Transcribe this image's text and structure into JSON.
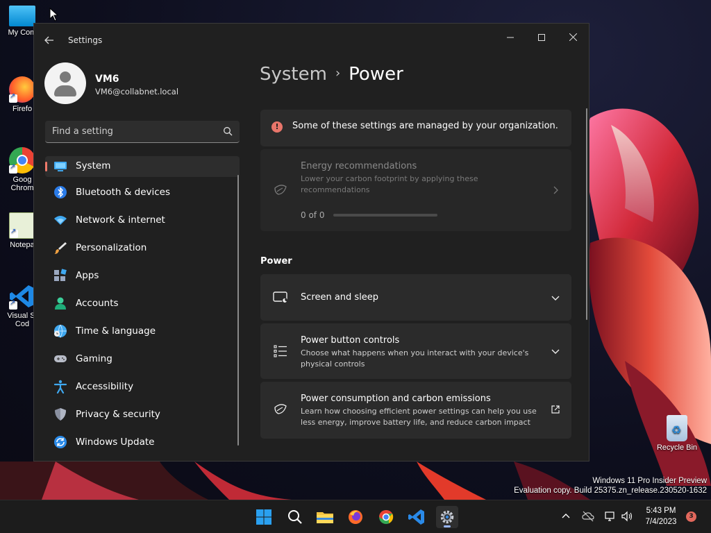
{
  "desktop": {
    "icons": [
      {
        "label": "My Com"
      },
      {
        "label": "Firefo"
      },
      {
        "label": "Goog Chrom"
      },
      {
        "label": "Notepa"
      },
      {
        "label": "Visual St Cod"
      },
      {
        "label": "Recycle Bin"
      }
    ],
    "watermark": {
      "line1": "Windows 11 Pro Insider Preview",
      "line2": "Evaluation copy. Build 25375.zn_release.230520-1632"
    }
  },
  "window": {
    "title": "Settings",
    "controls": {
      "minimize": "—",
      "maximize": "☐",
      "close": "✕"
    }
  },
  "profile": {
    "name": "VM6",
    "email": "VM6@collabnet.local"
  },
  "search": {
    "placeholder": "Find a setting"
  },
  "sidebar": {
    "items": [
      {
        "label": "System",
        "icon": "system-icon",
        "selected": true
      },
      {
        "label": "Bluetooth & devices",
        "icon": "bluetooth-icon"
      },
      {
        "label": "Network & internet",
        "icon": "wifi-icon"
      },
      {
        "label": "Personalization",
        "icon": "brush-icon"
      },
      {
        "label": "Apps",
        "icon": "apps-icon"
      },
      {
        "label": "Accounts",
        "icon": "person-icon"
      },
      {
        "label": "Time & language",
        "icon": "globe-clock-icon"
      },
      {
        "label": "Gaming",
        "icon": "gamepad-icon"
      },
      {
        "label": "Accessibility",
        "icon": "accessibility-icon"
      },
      {
        "label": "Privacy & security",
        "icon": "shield-icon"
      },
      {
        "label": "Windows Update",
        "icon": "update-icon"
      }
    ]
  },
  "content": {
    "breadcrumb": {
      "parent": "System",
      "separator": "›",
      "current": "Power"
    },
    "banner": {
      "icon": "!",
      "text": "Some of these settings are managed by your organization."
    },
    "energy": {
      "title": "Energy recommendations",
      "description": "Lower your carbon footprint by applying these recommendations",
      "count": "0 of 0",
      "progress": 0
    },
    "section_label": "Power",
    "cards": [
      {
        "title": "Screen and sleep",
        "description": ""
      },
      {
        "title": "Power button controls",
        "description": "Choose what happens when you interact with your device's physical controls"
      },
      {
        "title": "Power consumption and carbon emissions",
        "description": "Learn how choosing efficient power settings can help you use less energy, improve battery life, and reduce carbon impact"
      }
    ]
  },
  "taskbar": {
    "time": "5:43 PM",
    "date": "7/4/2023",
    "notifications": "3"
  },
  "colors": {
    "accent": "#f07a6a",
    "window_bg": "#202020",
    "card_bg": "#2b2b2b",
    "taskbar_bg": "#1c1c1c"
  }
}
